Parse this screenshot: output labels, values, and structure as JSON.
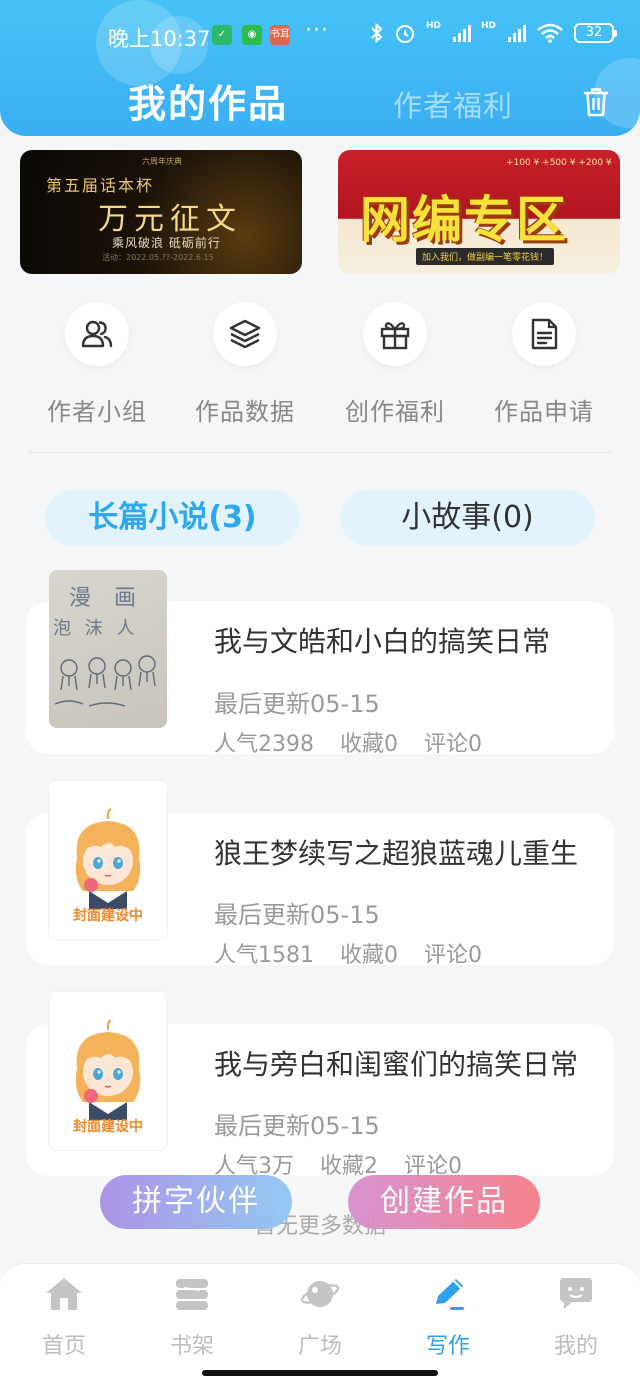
{
  "status_bar": {
    "time": "晚上10:37",
    "app_badge": "书耳",
    "dots": "···",
    "hd1": "HD",
    "hd2": "HD",
    "battery": "32"
  },
  "header": {
    "tab_active": "我的作品",
    "tab_inactive": "作者福利",
    "trash_icon": "trash-icon"
  },
  "banners": {
    "left": {
      "top_text": "第五届话本杯",
      "tiny_text": "六周年庆典",
      "title": "万元征文",
      "subtitle": "乘风破浪 砥砺前行",
      "date": "活动：2022.05.??-2022.6.15"
    },
    "right": {
      "coins": "+100 ¥  +500 ¥  +200 ¥",
      "title": "网编专区",
      "strip": "加入我们，做副编一笔零花钱！"
    }
  },
  "quick_actions": [
    {
      "label": "作者小组",
      "icon": "users-icon"
    },
    {
      "label": "作品数据",
      "icon": "layers-icon"
    },
    {
      "label": "创作福利",
      "icon": "gift-icon"
    },
    {
      "label": "作品申请",
      "icon": "document-icon"
    }
  ],
  "segments": {
    "long_novel": "长篇小说(3)",
    "short_story": "小故事(0)"
  },
  "works": [
    {
      "title": "我与文皓和小白的搞笑日常",
      "updated": "最后更新05-15",
      "popularity": "人气2398",
      "favorites": "收藏0",
      "comments": "评论0",
      "cover_type": "photo",
      "cover_text_1": "漫 画",
      "cover_text_2": "泡 沫 人"
    },
    {
      "title": "狼王梦续写之超狼蓝魂儿重生",
      "updated": "最后更新05-15",
      "popularity": "人气1581",
      "favorites": "收藏0",
      "comments": "评论0",
      "cover_type": "default",
      "cover_caption": "封面建设中"
    },
    {
      "title": "我与旁白和闺蜜们的搞笑日常",
      "updated": "最后更新05-15",
      "popularity": "人气3万",
      "favorites": "收藏2",
      "comments": "评论0",
      "cover_type": "default",
      "cover_caption": "封面建设中"
    }
  ],
  "more_text": "暂无更多数据",
  "floating_buttons": {
    "partner": "拼字伙伴",
    "create": "创建作品"
  },
  "bottom_nav": [
    {
      "label": "首页",
      "icon": "home-icon"
    },
    {
      "label": "书架",
      "icon": "bookshelf-icon"
    },
    {
      "label": "广场",
      "icon": "planet-icon"
    },
    {
      "label": "写作",
      "icon": "pen-icon",
      "active": true
    },
    {
      "label": "我的",
      "icon": "chat-face-icon"
    }
  ],
  "colors": {
    "header": "#3aaef3",
    "accent": "#2f9ff0",
    "cover_caption": "#f08a2a"
  }
}
